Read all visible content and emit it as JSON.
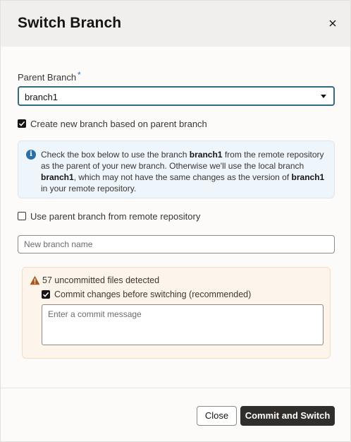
{
  "dialog": {
    "title": "Switch Branch",
    "close_icon": "close-icon"
  },
  "parent_branch": {
    "label": "Parent Branch",
    "required_mark": "*",
    "selected": "branch1"
  },
  "create_new_branch": {
    "checked": true,
    "label": "Create new branch based on parent branch"
  },
  "info": {
    "icon": "info-icon",
    "text_1": "Check the box below to use the branch ",
    "branch_1": "branch1",
    "text_2": " from the remote repository as the parent of your new branch. Otherwise we'll use the local branch ",
    "branch_2": "branch1",
    "text_3": ", which may not have the same changes as the version of ",
    "branch_3": "branch1",
    "text_4": " in your remote repository."
  },
  "use_remote": {
    "checked": false,
    "label": "Use parent branch from remote repository"
  },
  "new_branch": {
    "value": "",
    "placeholder": "New branch name"
  },
  "warning": {
    "icon": "warning-icon",
    "message": "57 uncommitted files detected",
    "commit_checkbox_checked": true,
    "commit_label": "Commit changes before switching (recommended)",
    "commit_message_value": "",
    "commit_message_placeholder": "Enter a commit message"
  },
  "footer": {
    "close_label": "Close",
    "primary_label": "Commit and Switch"
  }
}
